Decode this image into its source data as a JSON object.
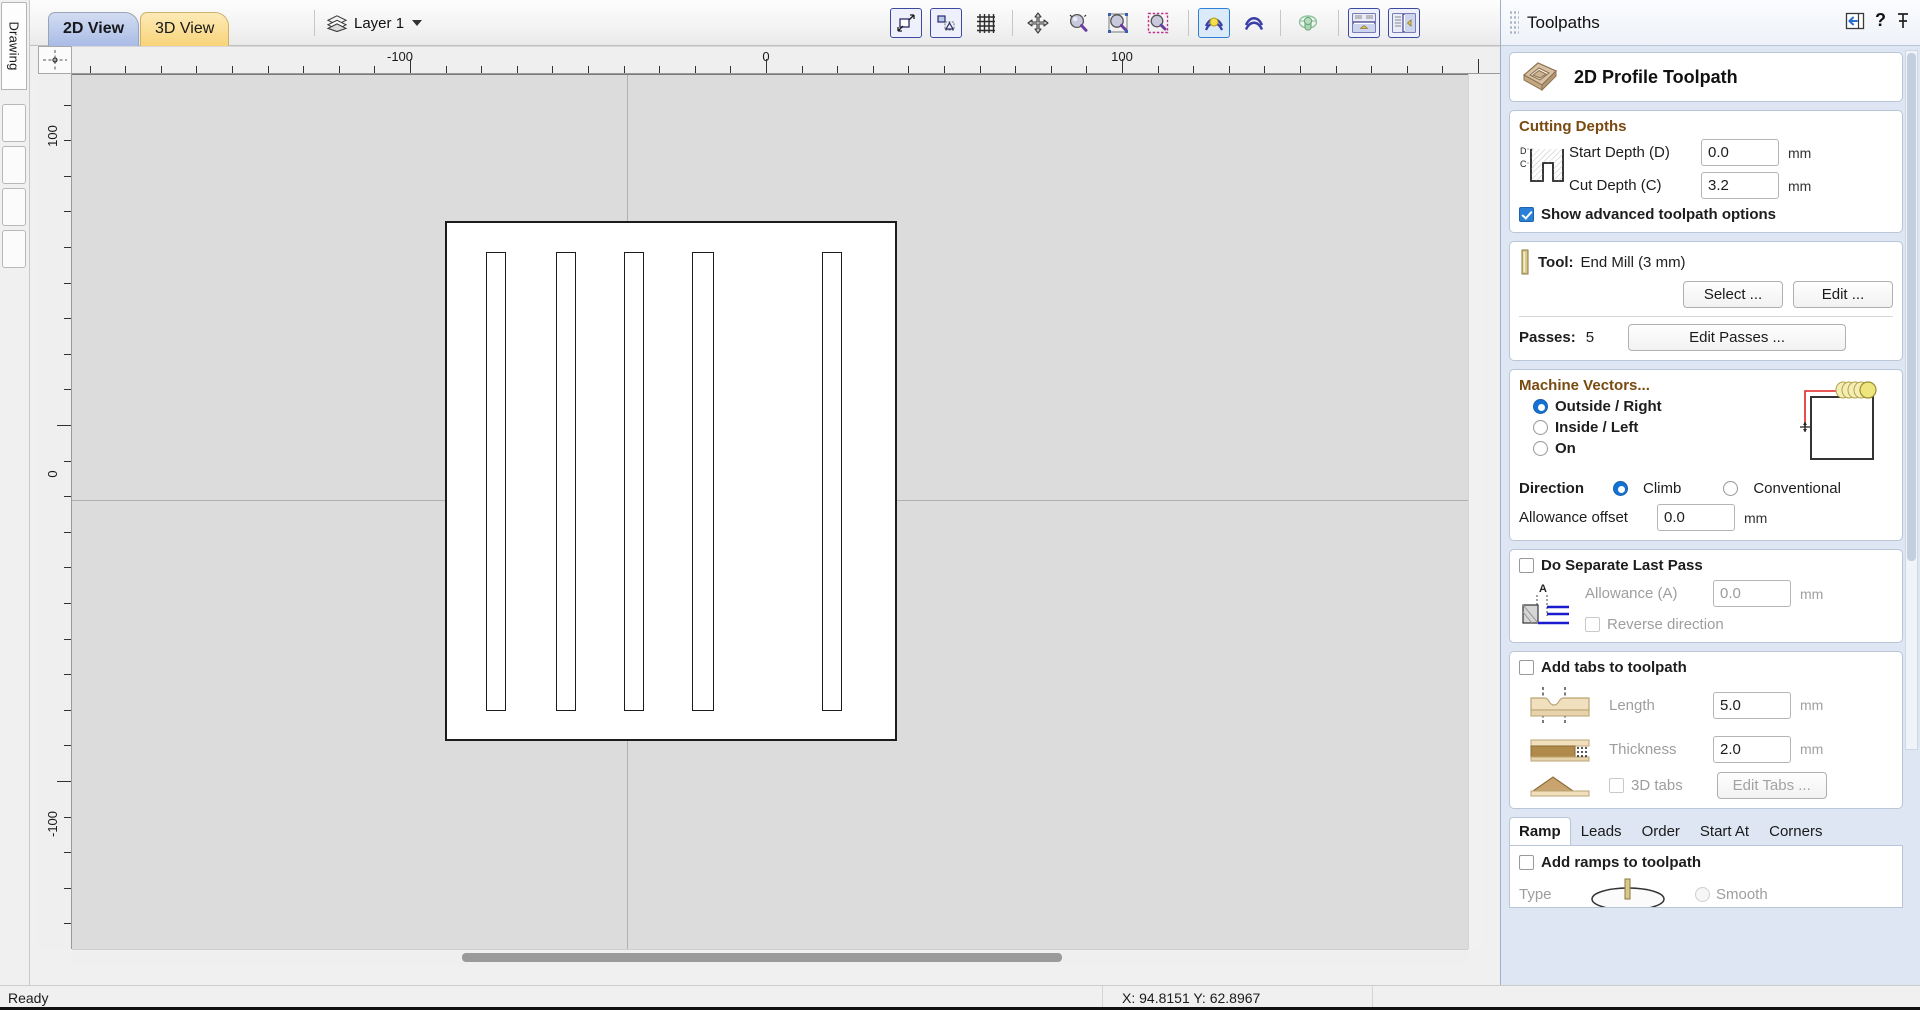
{
  "app": {
    "left_strip": {
      "drawing_tab_label": "Drawing"
    },
    "toolbar": {
      "tabs": [
        {
          "label": "2D View",
          "active": true
        },
        {
          "label": "3D View",
          "active": false
        }
      ],
      "layer": {
        "icon": "layers-icon",
        "label": "Layer 1",
        "caret": "chevron-down-icon"
      },
      "icons": [
        "zoom-to-drawing-icon",
        "zoom-to-selection-icon",
        "toggle-grid-icon",
        "pan-icon",
        "zoom-in-icon",
        "zoom-extents-icon",
        "zoom-selected-icon",
        "toggle-toolpath-preview-icon",
        "toggle-toolpath-icon",
        "toggle-3d-preview-icon",
        "split-view-horizontal-icon",
        "split-view-vertical-icon"
      ]
    },
    "rulers": {
      "h_labels": [
        "-100",
        "0",
        "100"
      ],
      "v_labels": [
        "100",
        "0",
        "-100"
      ],
      "units": "mm"
    },
    "canvas": {
      "material": {
        "label": "material-outline"
      },
      "slots_count": 5
    },
    "statusbar": {
      "status": "Ready",
      "coords": "X: 94.8151 Y: 62.8967"
    }
  },
  "toolpaths_panel": {
    "title": "Toolpaths",
    "header_icons": [
      "collapse-panel-icon",
      "help-icon",
      "pin-icon"
    ],
    "toolpath": {
      "icon": "profile-toolpath-icon",
      "name": "2D Profile Toolpath"
    },
    "cutting_depths": {
      "title": "Cutting Depths",
      "icon": "depth-diagram-icon",
      "start_depth_label": "Start Depth (D)",
      "start_depth_value": "0.0",
      "start_depth_unit": "mm",
      "cut_depth_label": "Cut Depth (C)",
      "cut_depth_value": "3.2",
      "cut_depth_unit": "mm",
      "advanced_label": "Show advanced toolpath options",
      "advanced_checked": true
    },
    "tool": {
      "icon": "end-mill-icon",
      "label": "Tool:",
      "value": "End Mill (3 mm)",
      "select_button": "Select ...",
      "edit_button": "Edit ...",
      "passes_label": "Passes:",
      "passes_value": "5",
      "edit_passes_button": "Edit Passes ..."
    },
    "machine_vectors": {
      "title": "Machine Vectors...",
      "options": [
        {
          "label": "Outside / Right",
          "selected": true
        },
        {
          "label": "Inside / Left",
          "selected": false
        },
        {
          "label": "On",
          "selected": false
        }
      ],
      "direction_label": "Direction",
      "direction_options": [
        {
          "label": "Climb",
          "selected": true
        },
        {
          "label": "Conventional",
          "selected": false
        }
      ],
      "allowance_label": "Allowance offset",
      "allowance_value": "0.0",
      "allowance_unit": "mm",
      "preview_icon": "offset-preview-icon"
    },
    "last_pass": {
      "title": "Do Separate Last Pass",
      "checked": false,
      "icon": "last-pass-diagram-icon",
      "allowance_label": "Allowance (A)",
      "allowance_value": "0.0",
      "allowance_unit": "mm",
      "reverse_label": "Reverse direction",
      "reverse_checked": false
    },
    "tabs_section": {
      "title": "Add tabs to toolpath",
      "checked": false,
      "length_label": "Length",
      "length_value": "5.0",
      "length_unit": "mm",
      "length_icon": "tab-length-icon",
      "thickness_label": "Thickness",
      "thickness_value": "2.0",
      "thickness_unit": "mm",
      "thickness_icon": "tab-thickness-icon",
      "tabs3d_label": "3D tabs",
      "tabs3d_checked": false,
      "tabs3d_icon": "tab-3d-icon",
      "edit_tabs_button": "Edit Tabs ..."
    },
    "bottom_tabs": {
      "tabs": [
        {
          "label": "Ramp",
          "active": true
        },
        {
          "label": "Leads",
          "active": false
        },
        {
          "label": "Order",
          "active": false
        },
        {
          "label": "Start At",
          "active": false
        },
        {
          "label": "Corners",
          "active": false
        }
      ],
      "ramp_pane": {
        "add_ramps_label": "Add ramps to toolpath",
        "add_ramps_checked": false,
        "type_label": "Type",
        "smooth_label": "Smooth",
        "smooth_selected": true,
        "ramp_icon": "ramp-diagram-icon"
      }
    }
  },
  "colors": {
    "accent_blue": "#1273d4",
    "group_title": "#7a4a10",
    "tab_2d": "#a9bce6",
    "tab_3d": "#f8d479",
    "canvas_bg": "#dcdcdc",
    "panel_bg": "#dde6f2"
  }
}
